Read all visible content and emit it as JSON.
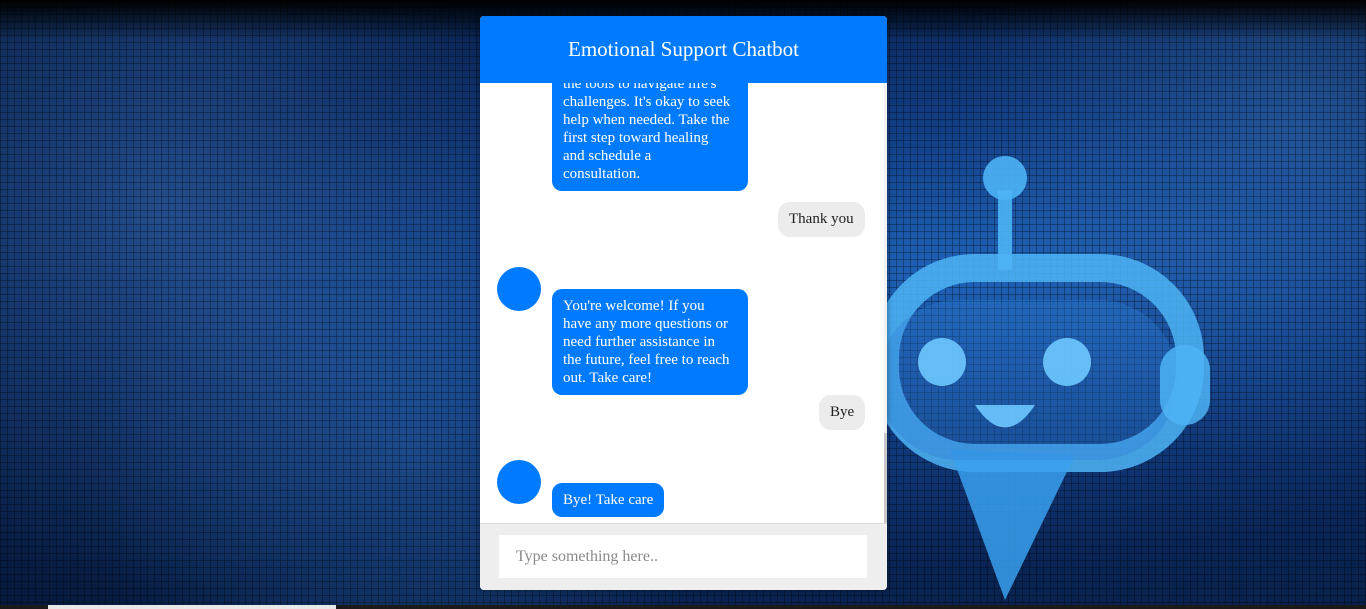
{
  "header": {
    "title": "Emotional Support Chatbot"
  },
  "messages": [
    {
      "sender": "bot",
      "lines": [
        "the tools to navigate life's",
        "challenges. It's okay to seek",
        "help when needed. Take the",
        "first step toward healing",
        "and schedule a",
        "consultation."
      ]
    },
    {
      "sender": "user",
      "text": "Thank you"
    },
    {
      "sender": "bot",
      "lines": [
        "You're welcome! If you",
        "have any more questions or",
        "need further assistance in",
        "the future, feel free to reach",
        "out. Take care!"
      ]
    },
    {
      "sender": "user",
      "text": "Bye"
    },
    {
      "sender": "bot",
      "text": "Bye! Take care"
    }
  ],
  "input": {
    "placeholder": "Type something here..",
    "value": ""
  },
  "colors": {
    "accent": "#007bff",
    "user_bubble": "#ececec"
  }
}
